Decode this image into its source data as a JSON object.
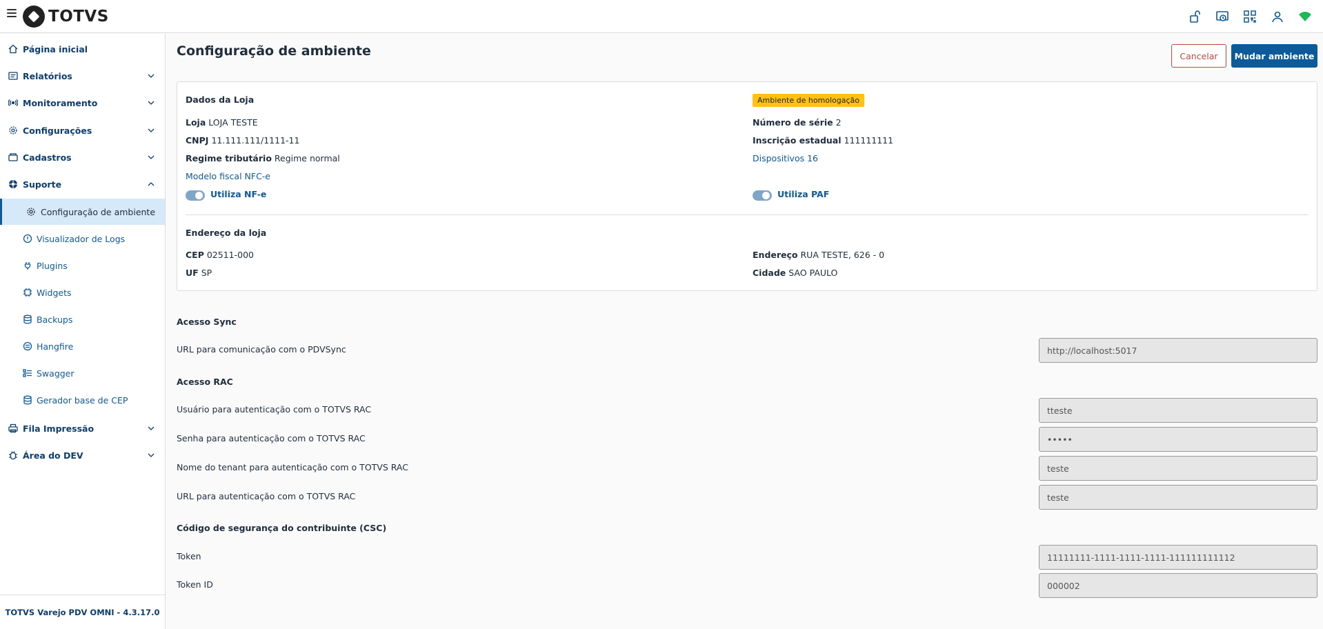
{
  "app": {
    "brand": "TOTVS"
  },
  "header_icons": [
    "unlock-icon",
    "clock-sync-icon",
    "qr-code-icon",
    "user-icon",
    "wifi-icon"
  ],
  "sidebar": {
    "items": [
      {
        "label": "Página inicial",
        "icon": "home-icon"
      },
      {
        "label": "Relatórios",
        "icon": "report-icon"
      },
      {
        "label": "Monitoramento",
        "icon": "broadcast-icon"
      },
      {
        "label": "Configurações",
        "icon": "gear-icon"
      },
      {
        "label": "Cadastros",
        "icon": "folder-icon"
      },
      {
        "label": "Suporte",
        "icon": "lifebuoy-icon"
      },
      {
        "label": "Fila Impressão",
        "icon": "printer-icon"
      },
      {
        "label": "Área do DEV",
        "icon": "bug-icon"
      }
    ],
    "sub_items": [
      {
        "label": "Configuração de ambiente",
        "icon": "gear-icon",
        "active": true
      },
      {
        "label": "Visualizador de Logs",
        "icon": "info-icon"
      },
      {
        "label": "Plugins",
        "icon": "plug-icon"
      },
      {
        "label": "Widgets",
        "icon": "chip-icon"
      },
      {
        "label": "Backups",
        "icon": "database-icon"
      },
      {
        "label": "Hangfire",
        "icon": "cog-circle-icon"
      },
      {
        "label": "Swagger",
        "icon": "list-icon"
      },
      {
        "label": "Gerador base de CEP",
        "icon": "database-icon"
      }
    ],
    "footer": "TOTVS Varejo PDV OMNI - 4.3.17.0"
  },
  "page": {
    "title": "Configuração de ambiente",
    "cancel_label": "Cancelar",
    "primary_label": "Mudar ambiente"
  },
  "store": {
    "section_title": "Dados da Loja",
    "badge": "Ambiente de homologação",
    "loja_label": "Loja",
    "loja_value": "LOJA TESTE",
    "cnpj_label": "CNPJ",
    "cnpj_value": "11.111.111/1111-11",
    "regime_label": "Regime tributário",
    "regime_value": "Regime normal",
    "modelo_label": "Modelo fiscal",
    "modelo_value": "NFC-e",
    "serie_label": "Número de série",
    "serie_value": "2",
    "ie_label": "Inscrição estadual",
    "ie_value": "111111111",
    "disp_label": "Dispositivos",
    "disp_value": "16",
    "nfe_label": "Utiliza NF-e",
    "paf_label": "Utiliza PAF"
  },
  "address": {
    "section_title": "Endereço da loja",
    "cep_label": "CEP",
    "cep_value": "02511-000",
    "uf_label": "UF",
    "uf_value": "SP",
    "end_label": "Endereço",
    "end_value": "RUA TESTE, 626 - 0",
    "cidade_label": "Cidade",
    "cidade_value": "SAO PAULO"
  },
  "sync": {
    "title": "Acesso Sync",
    "url_label": "URL para comunicação com o PDVSync",
    "url_value": "http://localhost:5017"
  },
  "rac": {
    "title": "Acesso RAC",
    "user_label": "Usuário para autenticação com o TOTVS RAC",
    "user_value": "tteste",
    "pass_label": "Senha para autenticação com o TOTVS RAC",
    "pass_value": "teste",
    "tenant_label": "Nome do tenant para autenticação com o TOTVS RAC",
    "tenant_value": "teste",
    "url_label": "URL para autenticação com o TOTVS RAC",
    "url_value": "teste"
  },
  "csc": {
    "title": "Código de segurança do contribuinte (CSC)",
    "token_label": "Token",
    "token_value": "11111111-1111-1111-1111-111111111112",
    "tokenid_label": "Token ID",
    "tokenid_value": "000002"
  },
  "colors": {
    "primary": "#0c5a99",
    "danger": "#c0473e",
    "badge": "#ffc20e",
    "active_bg": "#d5e9f8"
  }
}
